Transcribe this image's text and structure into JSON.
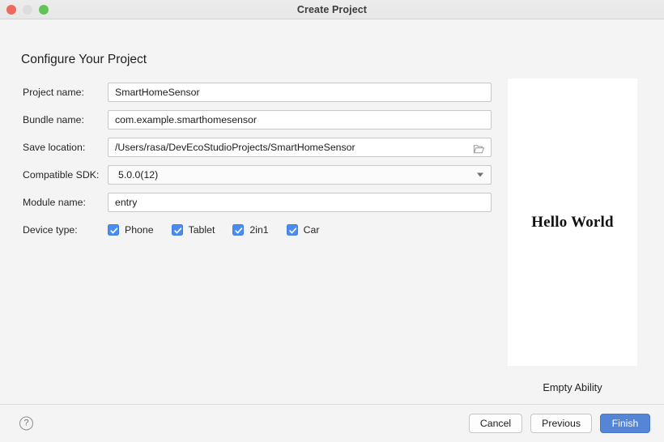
{
  "window": {
    "title": "Create Project",
    "traffic_lights": [
      {
        "name": "close",
        "color": "#ed6a5e"
      },
      {
        "name": "minimize",
        "color": "#dddddd"
      },
      {
        "name": "zoom",
        "color": "#61c554"
      }
    ]
  },
  "page": {
    "heading": "Configure Your Project"
  },
  "form": {
    "fields": [
      {
        "label": "Project name:",
        "value": "SmartHomeSensor"
      },
      {
        "label": "Bundle name:",
        "value": "com.example.smarthomesensor"
      },
      {
        "label": "Save location:",
        "value": "/Users/rasa/DevEcoStudioProjects/SmartHomeSensor"
      },
      {
        "label": "Compatible SDK:",
        "value": "5.0.0(12)"
      },
      {
        "label": "Module name:",
        "value": "entry"
      }
    ],
    "device_type": {
      "label": "Device type:",
      "options": [
        {
          "label": "Phone",
          "checked": true
        },
        {
          "label": "Tablet",
          "checked": true
        },
        {
          "label": "2in1",
          "checked": true
        },
        {
          "label": "Car",
          "checked": true
        }
      ]
    },
    "checkbox_color": "#4a8cf0"
  },
  "preview": {
    "screen_text": "Hello World",
    "caption": "Empty Ability"
  },
  "footer": {
    "help_glyph": "?",
    "buttons": [
      {
        "name": "cancel",
        "label": "Cancel",
        "style": "secondary"
      },
      {
        "name": "previous",
        "label": "Previous",
        "style": "secondary"
      },
      {
        "name": "finish",
        "label": "Finish",
        "style": "primary"
      }
    ],
    "primary_color": "#5585d6"
  }
}
